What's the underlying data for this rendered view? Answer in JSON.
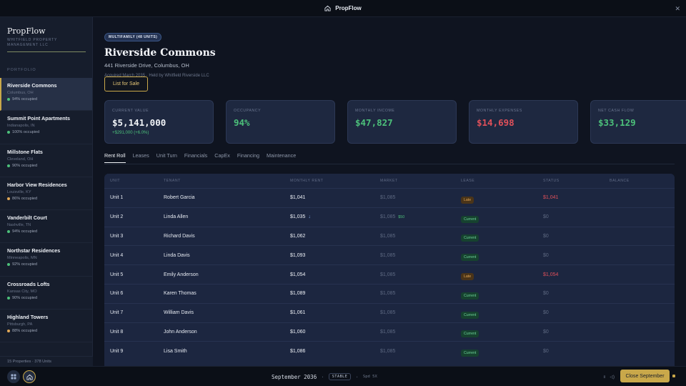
{
  "app": {
    "name": "PropFlow"
  },
  "sidebar": {
    "brand_name": "PropFlow",
    "brand_sub": "Whitfield Property Management LLC",
    "section_label": "PORTFOLIO",
    "properties": [
      {
        "name": "Riverside Commons",
        "city": "Columbus, OH",
        "occupancy": "94% occupied",
        "dot": "#4cc07a"
      },
      {
        "name": "Summit Point Apartments",
        "city": "Indianapolis, IN",
        "occupancy": "100% occupied",
        "dot": "#4cc07a"
      },
      {
        "name": "Millstone Flats",
        "city": "Cleveland, OH",
        "occupancy": "90% occupied",
        "dot": "#4cc07a"
      },
      {
        "name": "Harbor View Residences",
        "city": "Louisville, KY",
        "occupancy": "86% occupied",
        "dot": "#e2a857"
      },
      {
        "name": "Vanderbilt Court",
        "city": "Nashville, TN",
        "occupancy": "94% occupied",
        "dot": "#4cc07a"
      },
      {
        "name": "Northstar Residences",
        "city": "Minneapolis, MN",
        "occupancy": "92% occupied",
        "dot": "#4cc07a"
      },
      {
        "name": "Crossroads Lofts",
        "city": "Kansas City, MO",
        "occupancy": "90% occupied",
        "dot": "#4cc07a"
      },
      {
        "name": "Highland Towers",
        "city": "Pittsburgh, PA",
        "occupancy": "88% occupied",
        "dot": "#e2a857"
      }
    ],
    "footer": "15 Properties · 378 Units"
  },
  "header": {
    "badge": "MULTIFAMILY (48 UNITS)",
    "title": "Riverside Commons",
    "address": "441 Riverside Drive, Columbus, OH",
    "acquired": "Acquired March 2035 · Held by Whitfield Riverside LLC",
    "list_button": "List for Sale"
  },
  "cards": [
    {
      "label": "CURRENT VALUE",
      "value": "$5,141,000",
      "delta": "+$291,000 (+6.0%)",
      "color": "#f1f4f8"
    },
    {
      "label": "OCCUPANCY",
      "value": "94%",
      "delta": "",
      "color": "#4cc07a"
    },
    {
      "label": "MONTHLY INCOME",
      "value": "$47,827",
      "delta": "",
      "color": "#4cc07a"
    },
    {
      "label": "MONTHLY EXPENSES",
      "value": "$14,698",
      "delta": "",
      "color": "#e0505a"
    },
    {
      "label": "NET CASH FLOW",
      "value": "$33,129",
      "delta": "",
      "color": "#4cc07a"
    }
  ],
  "tabs": [
    "Rent Roll",
    "Leases",
    "Unit Turn",
    "Financials",
    "CapEx",
    "Financing",
    "Maintenance"
  ],
  "table": {
    "headers": [
      "UNIT",
      "TENANT",
      "MONTHLY RENT",
      "MARKET",
      "LEASE",
      "STATUS",
      "BALANCE"
    ],
    "rows": [
      {
        "unit": "Unit 1",
        "tenant": "Robert Garcia",
        "rent": "$1,041",
        "market": "$1,085",
        "gap": "",
        "lease": "Late",
        "status": "$1,041",
        "status_color": "#e0505a"
      },
      {
        "unit": "Unit 2",
        "tenant": "Linda Allen",
        "rent": "$1,035",
        "market": "$1,085",
        "gap": "$50",
        "lease": "Current",
        "status": "$0",
        "status_color": "#5e6982"
      },
      {
        "unit": "Unit 3",
        "tenant": "Richard Davis",
        "rent": "$1,062",
        "market": "$1,085",
        "gap": "",
        "lease": "Current",
        "status": "$0",
        "status_color": "#5e6982"
      },
      {
        "unit": "Unit 4",
        "tenant": "Linda Davis",
        "rent": "$1,093",
        "market": "$1,085",
        "gap": "",
        "lease": "Current",
        "status": "$0",
        "status_color": "#5e6982"
      },
      {
        "unit": "Unit 5",
        "tenant": "Emily Anderson",
        "rent": "$1,054",
        "market": "$1,085",
        "gap": "",
        "lease": "Late",
        "status": "$1,054",
        "status_color": "#e0505a"
      },
      {
        "unit": "Unit 6",
        "tenant": "Karen Thomas",
        "rent": "$1,089",
        "market": "$1,085",
        "gap": "",
        "lease": "Current",
        "status": "$0",
        "status_color": "#5e6982"
      },
      {
        "unit": "Unit 7",
        "tenant": "William Davis",
        "rent": "$1,061",
        "market": "$1,085",
        "gap": "",
        "lease": "Current",
        "status": "$0",
        "status_color": "#5e6982"
      },
      {
        "unit": "Unit 8",
        "tenant": "John Anderson",
        "rent": "$1,060",
        "market": "$1,085",
        "gap": "",
        "lease": "Current",
        "status": "$0",
        "status_color": "#5e6982"
      },
      {
        "unit": "Unit 9",
        "tenant": "Lisa Smith",
        "rent": "$1,086",
        "market": "$1,085",
        "gap": "",
        "lease": "Current",
        "status": "$0",
        "status_color": "#5e6982"
      }
    ]
  },
  "bottombar": {
    "date": "September 2036",
    "state": "STABLE",
    "speed": "Spd 5X",
    "close_button": "Close September"
  }
}
